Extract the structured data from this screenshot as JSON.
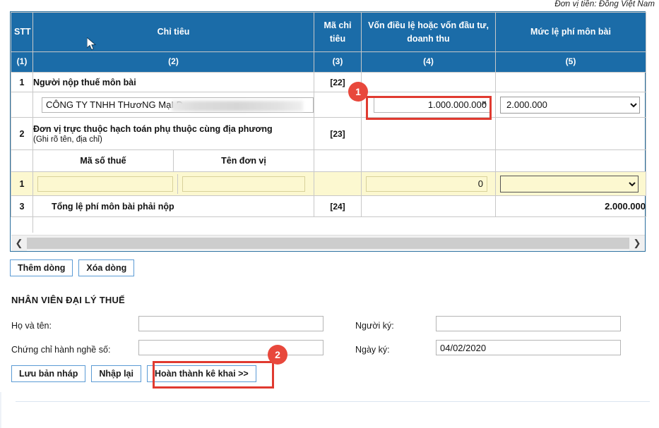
{
  "currency_note": "Đơn vị tiền: Đồng Việt Nam",
  "table": {
    "headers": [
      {
        "label": "STT",
        "code": "(1)"
      },
      {
        "label": "Chỉ tiêu",
        "code": "(2)"
      },
      {
        "label": "Mã chỉ tiêu",
        "code": "(3)"
      },
      {
        "label": "Vốn điều lệ hoặc vốn đầu tư, doanh thu",
        "code": "(4)"
      },
      {
        "label": "Mức lệ phí môn bài",
        "code": "(5)"
      }
    ],
    "rows": {
      "row1": {
        "stt": "1",
        "label": "Người nộp thuế môn bài",
        "ma": "[22]",
        "company_value": "CÔNG TY TNHH THươNG MạI D",
        "von_value": "1.000.000.000",
        "clear_icon": "×",
        "muc_value": "2.000.000"
      },
      "row2": {
        "stt": "2",
        "label": "Đơn vị trực thuộc hạch toán phụ thuộc cùng địa phương",
        "sublabel": "(Ghi rõ tên, địa chỉ)",
        "ma": "[23]"
      },
      "subheader": {
        "ma_so_thue": "Mã số thuế",
        "ten_don_vi": "Tên đơn vị"
      },
      "detail_row": {
        "stt": "1",
        "ma_so_thue_value": "",
        "ten_don_vi_value": "",
        "von_value": "0",
        "muc_value": ""
      },
      "row3": {
        "stt": "3",
        "label": "Tổng lệ phí môn bài phải nộp",
        "ma": "[24]",
        "von_value": "",
        "muc_value": "2.000.000"
      }
    },
    "scrollbar": {
      "left_arrow": "❮",
      "right_arrow": "❯"
    }
  },
  "row_buttons": {
    "add": "Thêm dòng",
    "delete": "Xóa dòng"
  },
  "agent_section": {
    "title": "NHÂN VIÊN ĐẠI LÝ THUẾ",
    "fields": {
      "ho_va_ten_label": "Họ và tên:",
      "ho_va_ten_value": "",
      "chung_chi_label": "Chứng chỉ hành nghề số:",
      "chung_chi_value": "",
      "nguoi_ky_label": "Người ký:",
      "nguoi_ky_value": "",
      "ngay_ky_label": "Ngày ký:",
      "ngay_ky_value": "04/02/2020"
    }
  },
  "bottom_buttons": {
    "save_draft": "Lưu bản nháp",
    "reset": "Nhập lại",
    "complete": "Hoàn thành kê khai >>"
  },
  "annotations": {
    "badge_1": "1",
    "badge_2": "2"
  },
  "colors": {
    "header_blue": "#1b6ca8",
    "row_yellow": "#fcf8d0",
    "annotation_red": "#e03a30",
    "button_border_blue": "#5b9bd5"
  }
}
